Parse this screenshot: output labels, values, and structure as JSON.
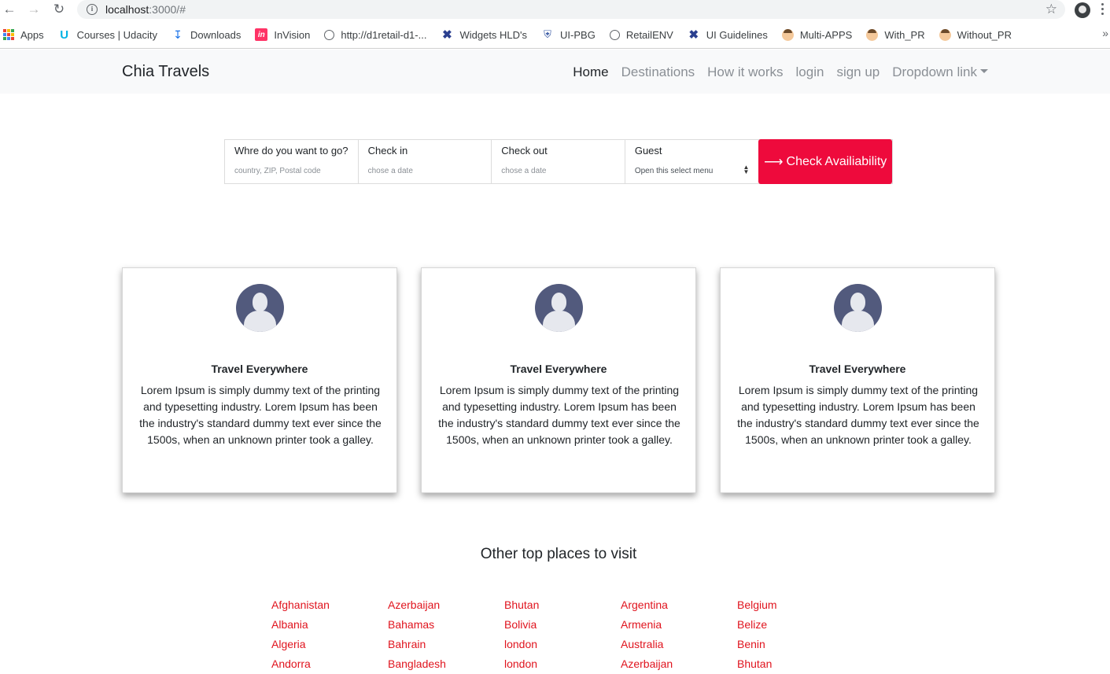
{
  "browser": {
    "url_host": "localhost",
    "url_rest": ":3000/#",
    "bookmarks": [
      {
        "label": "Apps",
        "icon": "apps-grid-icon"
      },
      {
        "label": "Courses | Udacity",
        "icon": "udacity-icon"
      },
      {
        "label": "Downloads",
        "icon": "download-icon"
      },
      {
        "label": "InVision",
        "icon": "invision-icon"
      },
      {
        "label": "http://d1retail-d1-...",
        "icon": "globe-icon"
      },
      {
        "label": "Widgets HLD's",
        "icon": "x-logo-icon"
      },
      {
        "label": "UI-PBG",
        "icon": "shield-icon"
      },
      {
        "label": "RetailENV",
        "icon": "globe-icon"
      },
      {
        "label": "UI Guidelines",
        "icon": "x-logo-icon"
      },
      {
        "label": "Multi-APPS",
        "icon": "avatar-icon"
      },
      {
        "label": "With_PR",
        "icon": "avatar-icon"
      },
      {
        "label": "Without_PR",
        "icon": "avatar-icon"
      }
    ],
    "more": "»"
  },
  "nav": {
    "brand": "Chia Travels",
    "links": [
      "Home",
      "Destinations",
      "How it works",
      "login",
      "sign up",
      "Dropdown link"
    ]
  },
  "search": {
    "fields": [
      {
        "label": "Whre do you want to go?",
        "placeholder": "country, ZIP, Postal code"
      },
      {
        "label": "Check in",
        "placeholder": "chose a date"
      },
      {
        "label": "Check out",
        "placeholder": "chose a date"
      }
    ],
    "guest": {
      "label": "Guest",
      "select_value": "Open this select menu"
    },
    "cta": "Check Availiability"
  },
  "cards": [
    {
      "title": "Travel Everywhere",
      "text": "Lorem Ipsum is simply dummy text of the printing and typesetting industry. Lorem Ipsum has been the industry's standard dummy text ever since the 1500s, when an unknown printer took a galley."
    },
    {
      "title": "Travel Everywhere",
      "text": "Lorem Ipsum is simply dummy text of the printing and typesetting industry. Lorem Ipsum has been the industry's standard dummy text ever since the 1500s, when an unknown printer took a galley."
    },
    {
      "title": "Travel Everywhere",
      "text": "Lorem Ipsum is simply dummy text of the printing and typesetting industry. Lorem Ipsum has been the industry's standard dummy text ever since the 1500s, when an unknown printer took a galley."
    }
  ],
  "places": {
    "title": "Other top places to visit",
    "columns": [
      [
        "Afghanistan",
        "Albania",
        "Algeria",
        "Andorra"
      ],
      [
        "Azerbaijan",
        "Bahamas",
        "Bahrain",
        "Bangladesh"
      ],
      [
        "Bhutan",
        "Bolivia",
        "london",
        "london"
      ],
      [
        "Argentina",
        "Armenia",
        "Australia",
        "Azerbaijan"
      ],
      [
        "Belgium",
        "Belize",
        "Benin",
        "Bhutan"
      ]
    ]
  },
  "colors": {
    "accent": "#ee0a3c",
    "link_red": "#e0141e",
    "avatar": "#525a7d"
  }
}
